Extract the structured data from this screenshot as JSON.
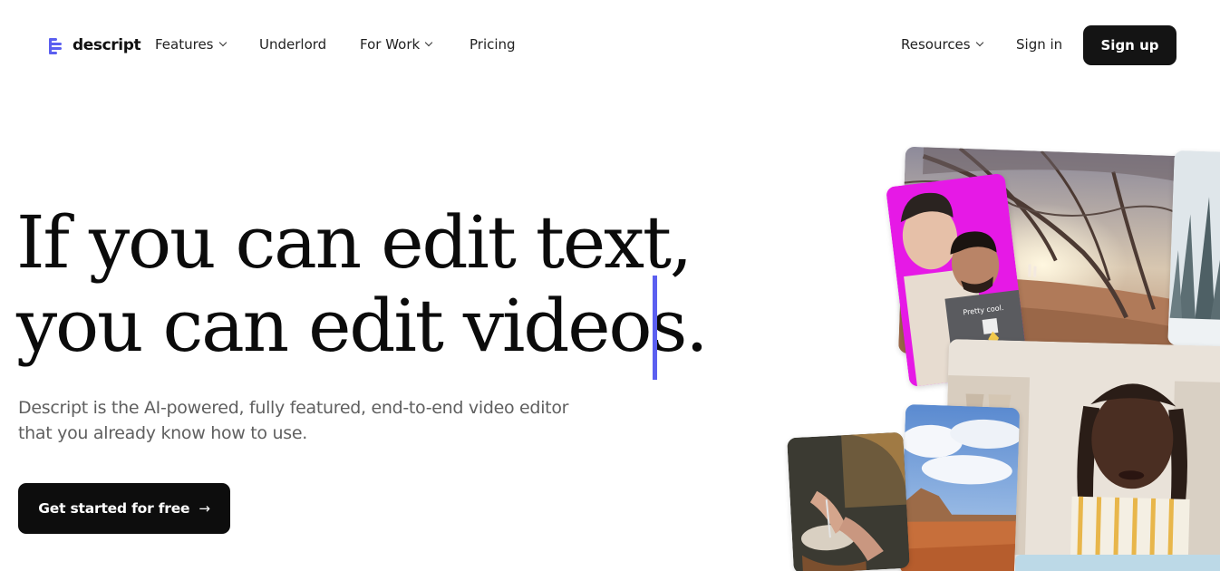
{
  "nav": {
    "logo_text": "descript",
    "logo_icon": "descript-logo-icon",
    "items": [
      {
        "label": "Features",
        "has_dropdown": true
      },
      {
        "label": "Underlord",
        "has_dropdown": false
      },
      {
        "label": "For Work",
        "has_dropdown": true
      },
      {
        "label": "Pricing",
        "has_dropdown": false
      }
    ],
    "right": {
      "resources_label": "Resources",
      "signin_label": "Sign in",
      "signup_label": "Sign up"
    }
  },
  "hero": {
    "headline_line1": "If you can edit text,",
    "headline_line2": "you can edit videos.",
    "subheadline_line1": "Descript is the AI-powered, fully featured, end-to-end video editor",
    "subheadline_line2": "that you already know how to use.",
    "cta_label": "Get started for free",
    "cta_icon": "arrow-right-icon"
  },
  "collage": {
    "caption_text": "Pretty cool.",
    "colors": {
      "magenta": "#e619e6",
      "caret": "#5b5ff0",
      "cta_bg": "#0d0d0d"
    }
  }
}
